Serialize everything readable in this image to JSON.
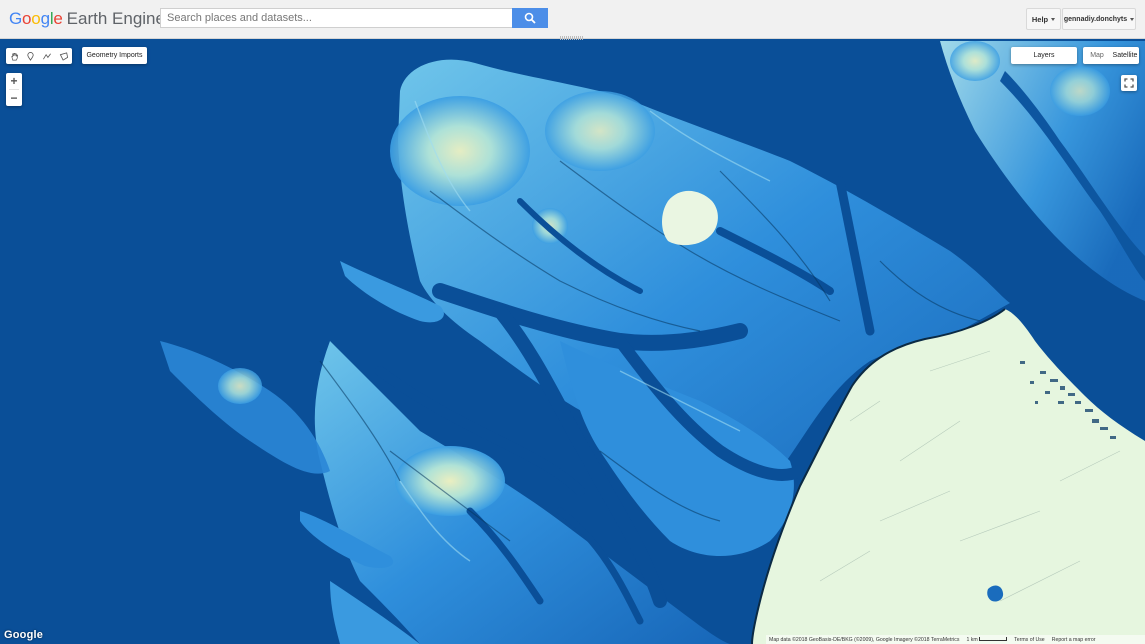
{
  "app": {
    "logo_google": "Google",
    "logo_product": "Earth Engine",
    "logo_colors": [
      "#4285f4",
      "#ea4335",
      "#fbbc05",
      "#4285f4",
      "#34a853",
      "#ea4335"
    ]
  },
  "search": {
    "placeholder": "Search places and datasets...",
    "button_color": "#4c8ee8",
    "icon": "search-icon"
  },
  "header": {
    "help_label": "Help",
    "user_label": "gennadiy.donchyts"
  },
  "map_controls": {
    "tools": [
      "hand-icon",
      "marker-icon",
      "polyline-icon",
      "polygon-icon"
    ],
    "geometry_imports_label": "Geometry Imports",
    "layers_label": "Layers",
    "map_type_options": [
      "Map",
      "Satellite"
    ],
    "zoom_in": "+",
    "zoom_out": "−",
    "fullscreen_icon": "fullscreen-icon"
  },
  "map": {
    "water_color": "#0a4f98",
    "land_light_color": "#e6f6df",
    "highland_color": "#f2f0b0"
  },
  "footer": {
    "watermark": "Google",
    "attribution": "Map data ©2018 GeoBasis-DE/BKG (©2009), Google Imagery ©2018 TerraMetrics",
    "scale_label": "1 km",
    "terms": "Terms of Use",
    "report": "Report a map error"
  }
}
